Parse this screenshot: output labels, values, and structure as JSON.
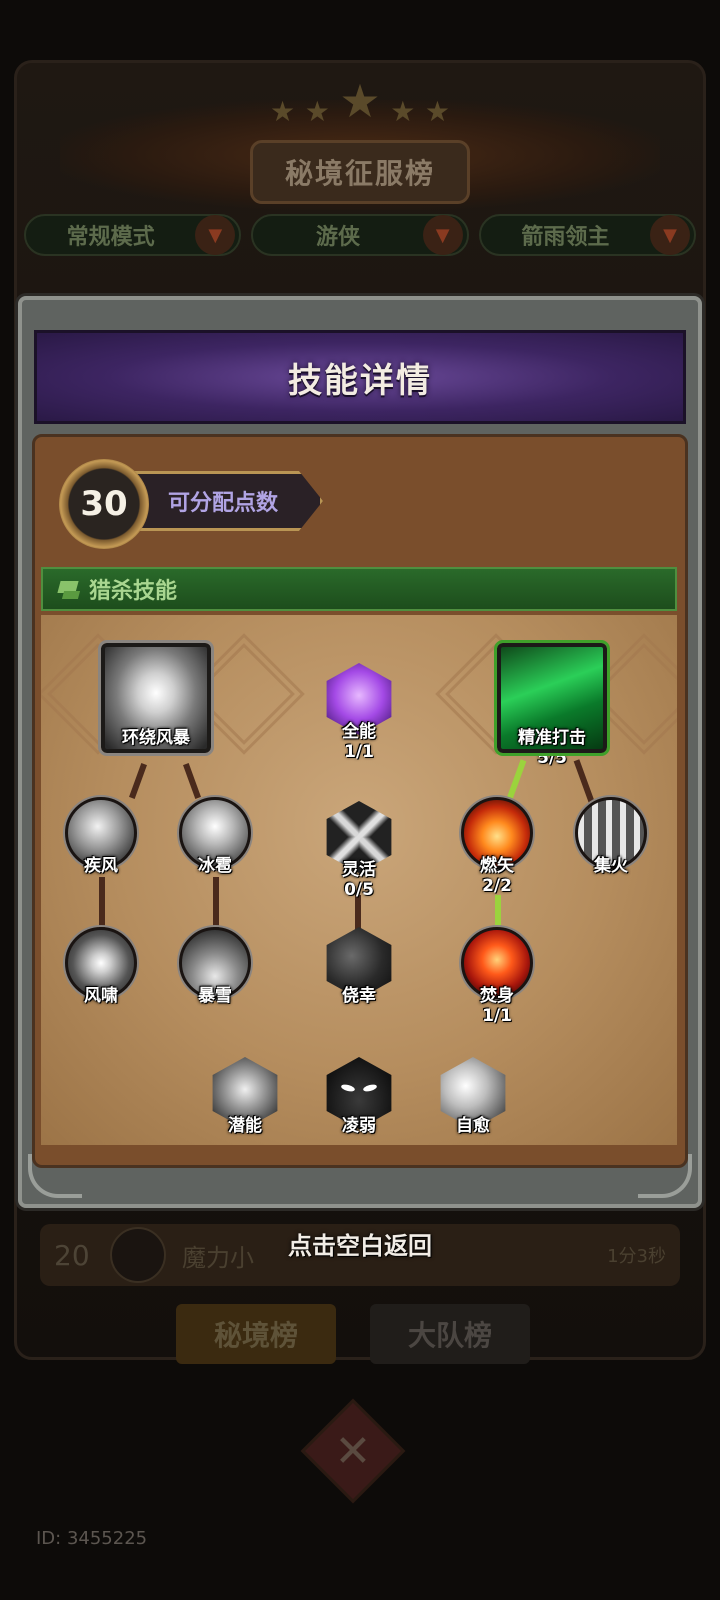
{
  "background": {
    "title": "秘境征服榜",
    "dropdowns": [
      {
        "label": "常规模式"
      },
      {
        "label": "游侠"
      },
      {
        "label": "箭雨领主"
      }
    ],
    "row": {
      "rank": "20",
      "name": "魔力小",
      "time": "1分3秒"
    },
    "tabs": [
      {
        "label": "秘境榜"
      },
      {
        "label": "大队榜"
      }
    ],
    "id_text": "ID: 3455225"
  },
  "modal": {
    "title": "技能详情",
    "points": {
      "value": "30",
      "label": "可分配点数"
    },
    "category": "猎杀技能",
    "skills": [
      {
        "key": "huanrao",
        "name": "环绕风暴",
        "level": ""
      },
      {
        "key": "quanneng",
        "name": "全能",
        "level": "1/1"
      },
      {
        "key": "jingzhun",
        "name": "精准打击",
        "level": "5/5"
      },
      {
        "key": "jifeng",
        "name": "疾风",
        "level": ""
      },
      {
        "key": "bingbao",
        "name": "冰雹",
        "level": ""
      },
      {
        "key": "linghuo",
        "name": "灵活",
        "level": "0/5"
      },
      {
        "key": "ranshi",
        "name": "燃矢",
        "level": "2/2"
      },
      {
        "key": "jihuo",
        "name": "集火",
        "level": ""
      },
      {
        "key": "fengxiao",
        "name": "风啸",
        "level": ""
      },
      {
        "key": "baoxue",
        "name": "暴雪",
        "level": ""
      },
      {
        "key": "jiaoxing",
        "name": "侥幸",
        "level": ""
      },
      {
        "key": "fenshen",
        "name": "焚身",
        "level": "1/1"
      },
      {
        "key": "qianneng",
        "name": "潜能",
        "level": ""
      },
      {
        "key": "lingruo",
        "name": "凌弱",
        "level": ""
      },
      {
        "key": "ziyu",
        "name": "自愈",
        "level": ""
      }
    ]
  },
  "hint": "点击空白返回",
  "colors": {
    "accent_purple": "#3d2562",
    "category_green": "#1d4d1c",
    "active_link": "#9bd33d",
    "inactive_link": "#4a2a1c"
  }
}
